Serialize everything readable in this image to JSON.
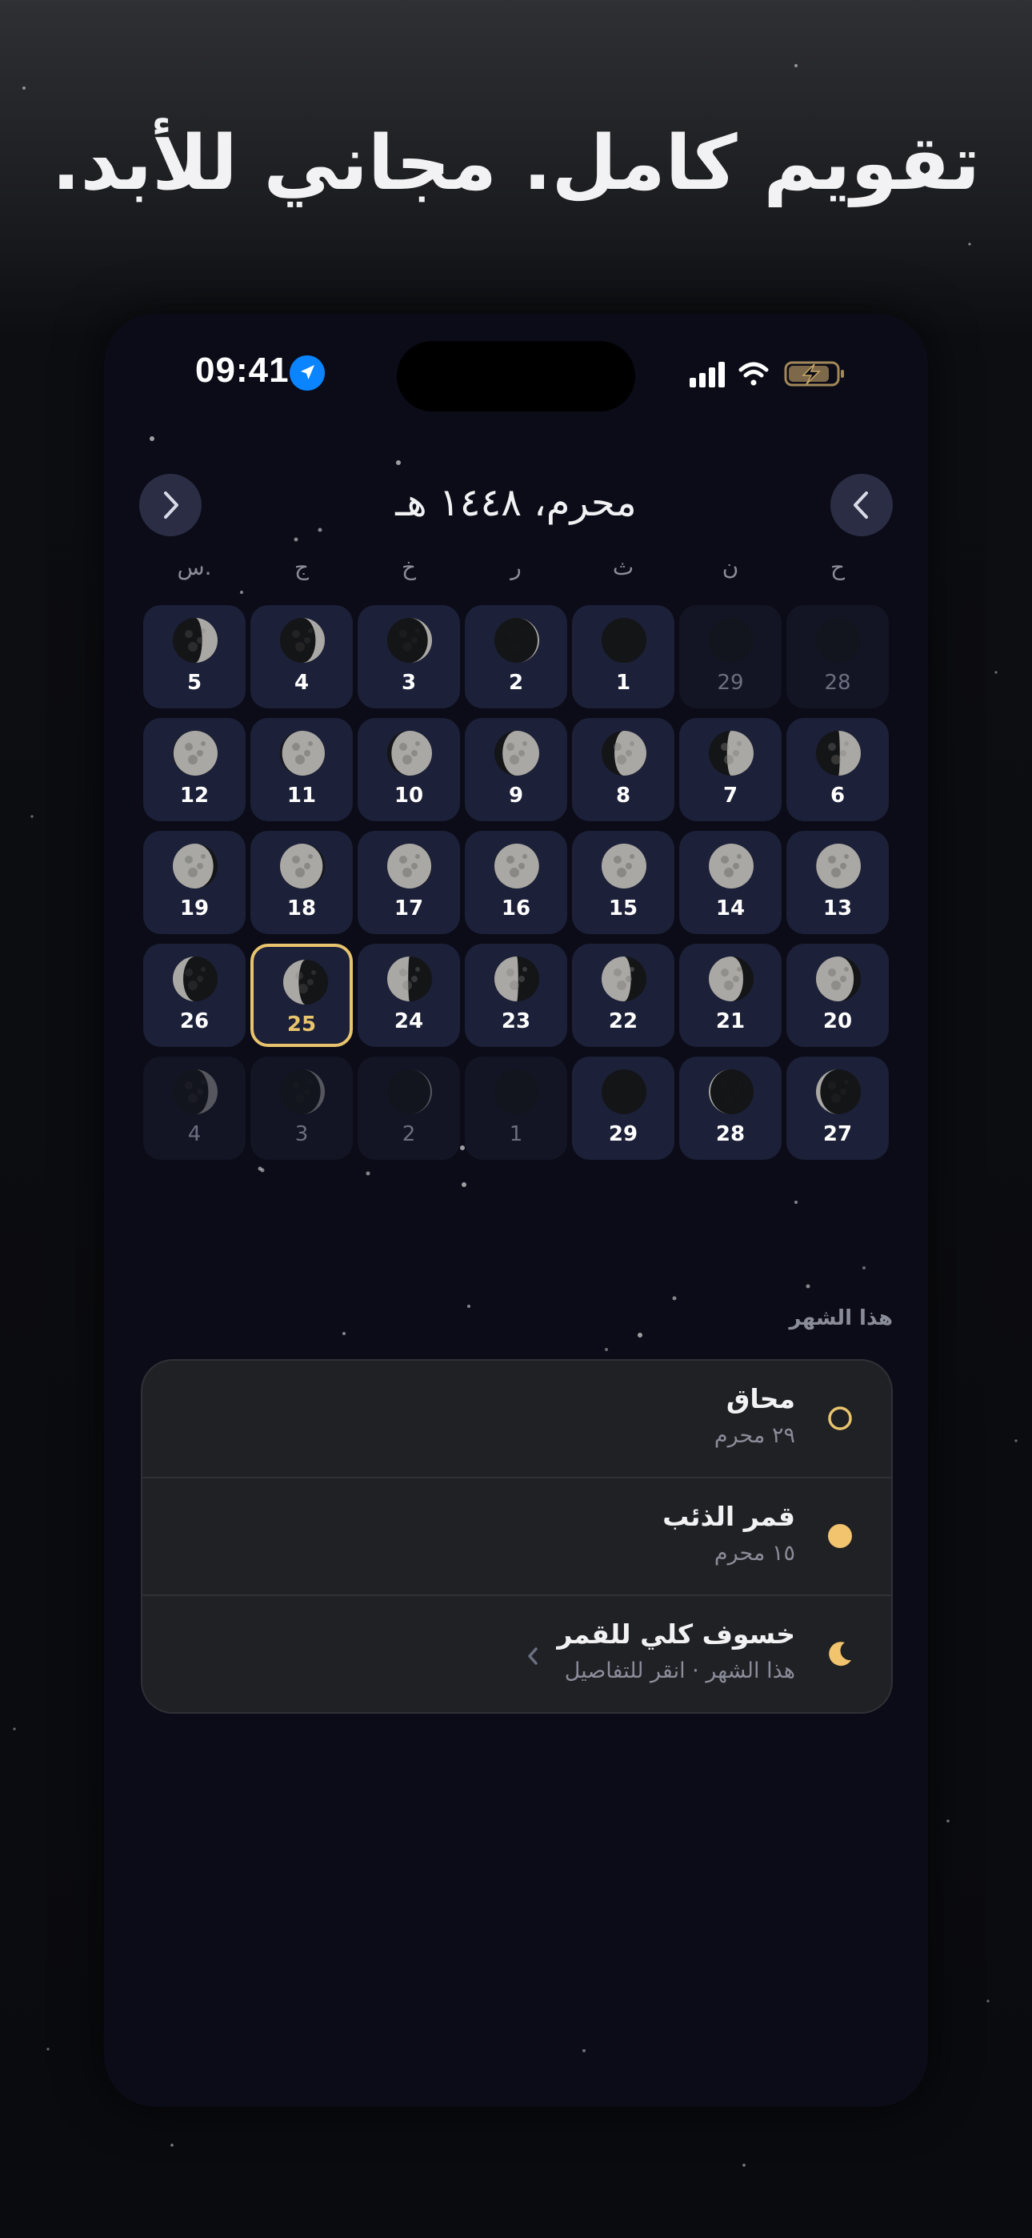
{
  "headline": "تقويم كامل. مجاني للأبد.",
  "status_bar": {
    "time": "09:41"
  },
  "calendar": {
    "month_title": "محرم، ١٤٤٨ هـ",
    "prev_label": "previous month",
    "next_label": "next month",
    "weekdays": [
      "ح",
      "ن",
      "ث",
      "ر",
      "خ",
      "ج",
      "س."
    ],
    "weeks": [
      [
        {
          "n": "28",
          "d": true,
          "p": 0.02
        },
        {
          "n": "29",
          "d": true,
          "p": 0.0
        },
        {
          "n": "1",
          "d": false,
          "p": 0.03
        },
        {
          "n": "2",
          "d": false,
          "p": 0.06
        },
        {
          "n": "3",
          "d": false,
          "p": 0.1
        },
        {
          "n": "4",
          "d": false,
          "p": 0.15
        },
        {
          "n": "5",
          "d": false,
          "p": 0.2
        }
      ],
      [
        {
          "n": "6",
          "d": false,
          "p": 0.24
        },
        {
          "n": "7",
          "d": false,
          "p": 0.28
        },
        {
          "n": "8",
          "d": false,
          "p": 0.32
        },
        {
          "n": "9",
          "d": false,
          "p": 0.36
        },
        {
          "n": "10",
          "d": false,
          "p": 0.4
        },
        {
          "n": "11",
          "d": false,
          "p": 0.43
        },
        {
          "n": "12",
          "d": false,
          "p": 0.46
        }
      ],
      [
        {
          "n": "13",
          "d": false,
          "p": 0.48
        },
        {
          "n": "14",
          "d": false,
          "p": 0.49
        },
        {
          "n": "15",
          "d": false,
          "p": 0.5
        },
        {
          "n": "16",
          "d": false,
          "p": 0.52
        },
        {
          "n": "17",
          "d": false,
          "p": 0.54
        },
        {
          "n": "18",
          "d": false,
          "p": 0.57
        },
        {
          "n": "19",
          "d": false,
          "p": 0.6
        }
      ],
      [
        {
          "n": "20",
          "d": false,
          "p": 0.63
        },
        {
          "n": "21",
          "d": false,
          "p": 0.66
        },
        {
          "n": "22",
          "d": false,
          "p": 0.7
        },
        {
          "n": "23",
          "d": false,
          "p": 0.74
        },
        {
          "n": "24",
          "d": false,
          "p": 0.76
        },
        {
          "n": "25",
          "d": false,
          "p": 0.8,
          "today": true
        },
        {
          "n": "26",
          "d": false,
          "p": 0.84
        }
      ],
      [
        {
          "n": "27",
          "d": false,
          "p": 0.9
        },
        {
          "n": "28",
          "d": false,
          "p": 0.94
        },
        {
          "n": "29",
          "d": false,
          "p": 0.99
        },
        {
          "n": "1",
          "d": true,
          "p": 0.03
        },
        {
          "n": "2",
          "d": true,
          "p": 0.06
        },
        {
          "n": "3",
          "d": true,
          "p": 0.1
        },
        {
          "n": "4",
          "d": true,
          "p": 0.15
        }
      ]
    ]
  },
  "this_month": {
    "label": "هذا الشهر",
    "events": [
      {
        "title": "محاق",
        "subtitle": "٢٩ محرم",
        "icon": "new-moon-ring-icon"
      },
      {
        "title": "قمر الذئب",
        "subtitle": "١٥ محرم",
        "icon": "full-moon-icon"
      },
      {
        "title": "خسوف كلي للقمر",
        "subtitle": "هذا الشهر · انقر للتفاصيل",
        "icon": "crescent-icon",
        "chevron": true
      }
    ]
  },
  "colors": {
    "accent": "#e8c46e",
    "cell": "#1c2038",
    "card": "#202124",
    "location": "#0a84ff"
  }
}
